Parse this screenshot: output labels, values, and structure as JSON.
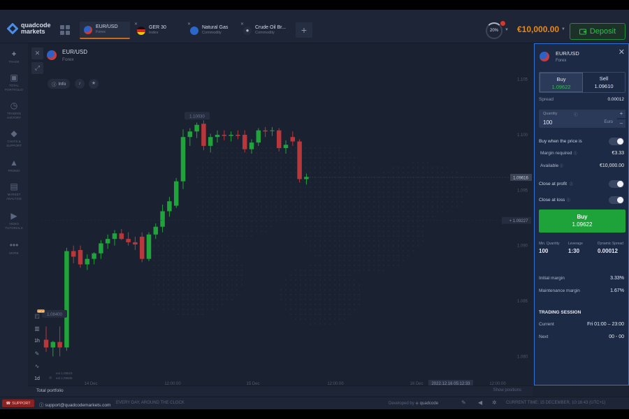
{
  "brand": {
    "line1": "quadcode",
    "line2": "markets"
  },
  "tabs": [
    {
      "name": "EUR/USD",
      "type": "Forex",
      "active": true,
      "icon": "eur-usd-flag-icon"
    },
    {
      "name": "GER 30",
      "type": "Index",
      "active": false,
      "icon": "germany-flag-icon"
    },
    {
      "name": "Natural Gas",
      "type": "Commodity",
      "active": false,
      "icon": "flame-icon"
    },
    {
      "name": "Crude Oil Br...",
      "type": "Commodity",
      "active": false,
      "icon": "oil-drop-icon"
    }
  ],
  "header": {
    "progress_label": "20%",
    "progress": 0.2,
    "balance": "€10,000.00",
    "deposit_label": "Deposit"
  },
  "nav": [
    {
      "label": "TRADE",
      "icon": "plus-icon"
    },
    {
      "label": "TOTAL PORTFOLIO",
      "icon": "briefcase-icon"
    },
    {
      "label": "TRADING HISTORY",
      "icon": "history-icon"
    },
    {
      "label": "CHATS & SUPPORT",
      "icon": "chat-icon"
    },
    {
      "label": "PROMO",
      "icon": "fire-icon"
    },
    {
      "label": "MARKET ANALYSIS",
      "icon": "news-icon"
    },
    {
      "label": "VIDEO TUTORIALS",
      "icon": "play-icon"
    },
    {
      "label": "MORE",
      "icon": "more-dots-icon"
    }
  ],
  "chart": {
    "asset_name": "EUR/USD",
    "asset_type": "Forex",
    "info_label": "Info",
    "timeframe": "1h",
    "candle_period": "1d",
    "new_badge": "NEW",
    "legend_high": "ext 1.09623",
    "legend_low": "ext 1.09606",
    "bottom_left": "Total portfolio",
    "bottom_right": "Show positions"
  },
  "chart_data": {
    "type": "candlestick",
    "x_ticks": [
      "14 Dec",
      "12:00:00",
      "15 Dec",
      "12:00:00",
      "16 Dec",
      "2022.12.16 05:12:33",
      "12:00:00"
    ],
    "y_ticks": [
      "1.105",
      "1.100",
      "1.095",
      "1.090",
      "1.085",
      "1.080"
    ],
    "ylim": [
      1.078,
      1.107
    ],
    "current_price_label": "1.09616",
    "secondary_price_label": "1.09227",
    "annotation_high": "1.10030",
    "annotation_low": "1.08400",
    "grid": false,
    "candles": [
      {
        "o": 1.0815,
        "h": 1.0827,
        "l": 1.0804,
        "c": 1.0808
      },
      {
        "o": 1.0808,
        "h": 1.0814,
        "l": 1.08,
        "c": 1.0813
      },
      {
        "o": 1.0813,
        "h": 1.0827,
        "l": 1.08,
        "c": 1.0808
      },
      {
        "o": 1.0808,
        "h": 1.0898,
        "l": 1.0805,
        "c": 1.0895
      },
      {
        "o": 1.0895,
        "h": 1.09,
        "l": 1.0884,
        "c": 1.089
      },
      {
        "o": 1.0896,
        "h": 1.09,
        "l": 1.088,
        "c": 1.0883
      },
      {
        "o": 1.0883,
        "h": 1.0892,
        "l": 1.0878,
        "c": 1.0888
      },
      {
        "o": 1.0888,
        "h": 1.0894,
        "l": 1.0883,
        "c": 1.0893
      },
      {
        "o": 1.0893,
        "h": 1.0905,
        "l": 1.0888,
        "c": 1.0902
      },
      {
        "o": 1.0902,
        "h": 1.091,
        "l": 1.0897,
        "c": 1.0906
      },
      {
        "o": 1.0906,
        "h": 1.0914,
        "l": 1.09,
        "c": 1.0911
      },
      {
        "o": 1.0911,
        "h": 1.0915,
        "l": 1.0905,
        "c": 1.0906
      },
      {
        "o": 1.0906,
        "h": 1.0912,
        "l": 1.09,
        "c": 1.0903
      },
      {
        "o": 1.0903,
        "h": 1.0908,
        "l": 1.0896,
        "c": 1.0901
      },
      {
        "o": 1.0908,
        "h": 1.0912,
        "l": 1.0885,
        "c": 1.0888
      },
      {
        "o": 1.0888,
        "h": 1.0912,
        "l": 1.0886,
        "c": 1.091
      },
      {
        "o": 1.091,
        "h": 1.092,
        "l": 1.0906,
        "c": 1.0917
      },
      {
        "o": 1.0917,
        "h": 1.0937,
        "l": 1.0912,
        "c": 1.0931
      },
      {
        "o": 1.0931,
        "h": 1.0944,
        "l": 1.0926,
        "c": 1.094
      },
      {
        "o": 1.0936,
        "h": 1.0961,
        "l": 1.0934,
        "c": 1.0958
      },
      {
        "o": 1.0958,
        "h": 1.1005,
        "l": 1.0951,
        "c": 1.0998
      },
      {
        "o": 1.0998,
        "h": 1.1006,
        "l": 1.099,
        "c": 1.1003
      },
      {
        "o": 1.1003,
        "h": 1.1011,
        "l": 1.0997,
        "c": 1.1009
      },
      {
        "o": 1.101,
        "h": 1.1013,
        "l": 1.0986,
        "c": 1.099
      },
      {
        "o": 1.099,
        "h": 1.1001,
        "l": 1.0984,
        "c": 1.0998
      },
      {
        "o": 1.0998,
        "h": 1.1004,
        "l": 1.0993,
        "c": 1.1
      },
      {
        "o": 1.1,
        "h": 1.1004,
        "l": 1.0995,
        "c": 1.0999
      },
      {
        "o": 1.0999,
        "h": 1.1003,
        "l": 1.0994,
        "c": 1.1
      },
      {
        "o": 1.1,
        "h": 1.1004,
        "l": 1.0996,
        "c": 1.0999
      },
      {
        "o": 1.1,
        "h": 1.1004,
        "l": 1.0984,
        "c": 1.0987
      },
      {
        "o": 1.0987,
        "h": 1.0996,
        "l": 1.0983,
        "c": 1.0993
      },
      {
        "o": 1.0993,
        "h": 1.1006,
        "l": 1.099,
        "c": 1.1004
      },
      {
        "o": 1.1004,
        "h": 1.1007,
        "l": 1.0998,
        "c": 1.1003
      },
      {
        "o": 1.1004,
        "h": 1.1007,
        "l": 1.0999,
        "c": 1.1004
      },
      {
        "o": 1.1004,
        "h": 1.1006,
        "l": 1.0985,
        "c": 1.0988
      },
      {
        "o": 1.0988,
        "h": 1.0995,
        "l": 1.0983,
        "c": 1.0991
      },
      {
        "o": 1.0998,
        "h": 1.1003,
        "l": 1.099,
        "c": 1.0994
      },
      {
        "o": 1.0994,
        "h": 1.0996,
        "l": 1.0957,
        "c": 1.096
      },
      {
        "o": 1.096,
        "h": 1.0965,
        "l": 1.0955,
        "c": 1.0962
      }
    ]
  },
  "panel": {
    "asset_name": "EUR/USD",
    "asset_type": "Forex",
    "buy_label": "Buy",
    "buy_price": "1.09622",
    "sell_label": "Sell",
    "sell_price": "1.09610",
    "spread_label": "Spread",
    "spread_value": "0.00012",
    "quantity_label": "Quantity",
    "quantity_value": "100",
    "quantity_unit": "Euro",
    "buy_when_label": "Buy when the price is",
    "margin_required_label": "Margin required",
    "margin_required_value": "€3.33",
    "available_label": "Available",
    "available_value": "€10,000.00",
    "close_profit_label": "Close at profit",
    "close_loss_label": "Close at loss",
    "buy_button_label": "Buy",
    "buy_button_price": "1.09622",
    "min_qty_label": "Min. Quantity",
    "min_qty_value": "100",
    "leverage_label": "Leverage",
    "leverage_value": "1:30",
    "dyn_spread_label": "Dynamic Spread",
    "dyn_spread_value": "0.00012",
    "initial_margin_label": "Initial margin",
    "initial_margin_value": "3.33%",
    "maint_margin_label": "Maintenance margin",
    "maint_margin_value": "1.67%",
    "session_title": "TRADING SESSION",
    "current_label": "Current",
    "current_value": "Fri 01:00 – 23:00",
    "next_label": "Next",
    "next_value": "00 - 00"
  },
  "footer": {
    "support_label": "SUPPORT",
    "email": "support@quadcodemarkets.com",
    "tagline": "EVERY DAY, AROUND THE CLOCK",
    "developed_by": "Developed by",
    "developer": "quadcode",
    "current_time": "CURRENT TIME: 15 DECEMBER, 10:16:43  (UTC+1)"
  },
  "colors": {
    "up": "#1fa33a",
    "down": "#b8373a",
    "accent": "#2f72d8",
    "balance": "#e28a1e"
  }
}
